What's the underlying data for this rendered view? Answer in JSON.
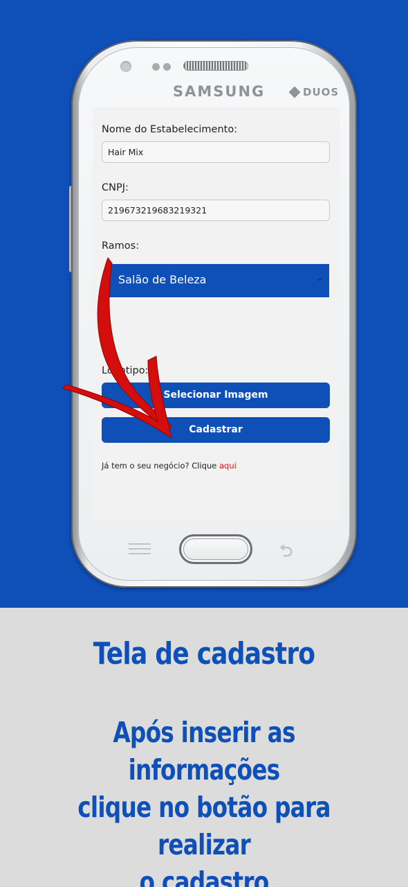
{
  "phone": {
    "brand": "SAMSUNG",
    "model_badge": "DUOS"
  },
  "form": {
    "name_label": "Nome do Estabelecimento:",
    "name_value": "Hair Mix",
    "cnpj_label": "CNPJ:",
    "cnpj_value": "219673219683219321",
    "ramos_label": "Ramos:",
    "ramos_selected": "Salão de Beleza",
    "logotipo_label": "Logotipo:",
    "select_image_button": "Selecionar Imagem",
    "submit_button": "Cadastrar",
    "login_prompt": "Já tem o seu negócio? Clique ",
    "login_link": "aqui"
  },
  "caption": {
    "title": "Tela de cadastro",
    "line1": "Após inserir as informações",
    "line2": "clique no botão para realizar",
    "line3": "o cadastro"
  },
  "colors": {
    "brand_blue": "#0f4fb8",
    "link_red": "#e01010",
    "arrow_red": "#d40d0d"
  }
}
